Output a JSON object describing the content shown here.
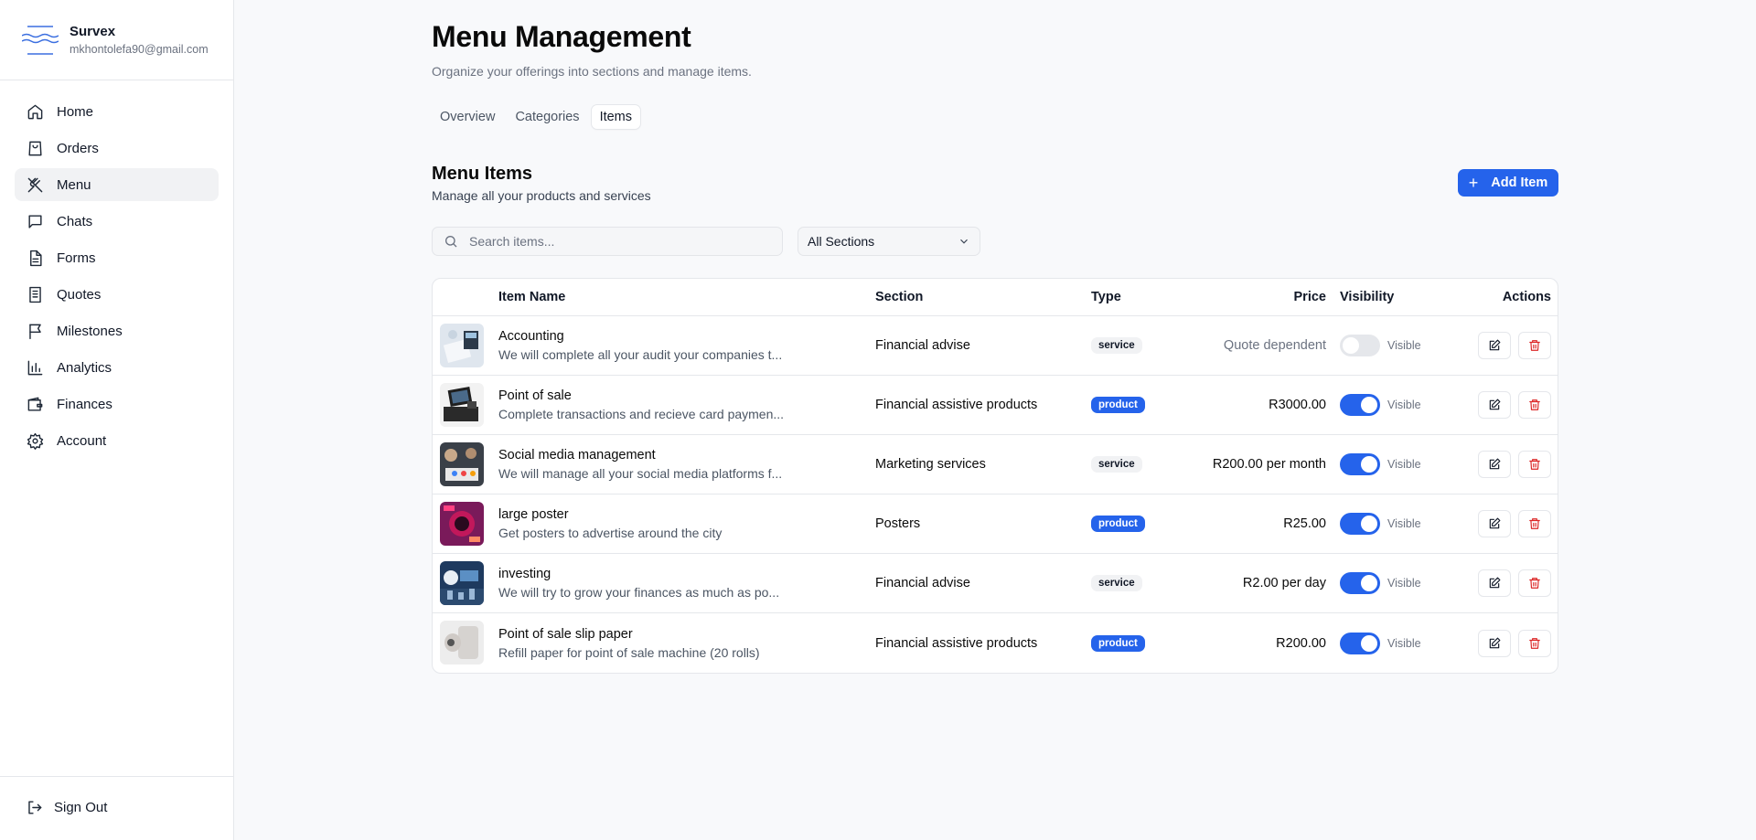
{
  "brand": {
    "name": "Survex",
    "email": "mkhontolefa90@gmail.com"
  },
  "sidebar": {
    "items": [
      {
        "label": "Home",
        "icon": "home-icon"
      },
      {
        "label": "Orders",
        "icon": "shopping-bag-icon"
      },
      {
        "label": "Menu",
        "icon": "utensils-icon",
        "active": true
      },
      {
        "label": "Chats",
        "icon": "message-square-icon"
      },
      {
        "label": "Forms",
        "icon": "file-text-icon"
      },
      {
        "label": "Quotes",
        "icon": "receipt-icon"
      },
      {
        "label": "Milestones",
        "icon": "flag-icon"
      },
      {
        "label": "Analytics",
        "icon": "bar-chart-icon"
      },
      {
        "label": "Finances",
        "icon": "wallet-icon"
      },
      {
        "label": "Account",
        "icon": "gear-icon"
      }
    ],
    "signout_label": "Sign Out"
  },
  "header": {
    "title": "Menu Management",
    "subtitle": "Organize your offerings into sections and manage items."
  },
  "tabs": [
    {
      "label": "Overview"
    },
    {
      "label": "Categories"
    },
    {
      "label": "Items",
      "active": true
    }
  ],
  "items_section": {
    "title": "Menu Items",
    "subtitle": "Manage all your products and services",
    "add_label": "Add Item",
    "search_placeholder": "Search items...",
    "section_filter": "All Sections"
  },
  "table": {
    "headers": {
      "name": "Item Name",
      "section": "Section",
      "type": "Type",
      "price": "Price",
      "visibility": "Visibility",
      "actions": "Actions"
    },
    "rows": [
      {
        "name": "Accounting",
        "desc": "We will complete all your audit your companies t...",
        "section": "Financial advise",
        "type": "service",
        "price": "Quote dependent",
        "visible": false,
        "vis_label": "Visible"
      },
      {
        "name": "Point of sale",
        "desc": "Complete transactions and recieve card paymen...",
        "section": "Financial assistive products",
        "type": "product",
        "price": "R3000.00",
        "visible": true,
        "vis_label": "Visible"
      },
      {
        "name": "Social media management",
        "desc": "We will manage all your social media platforms f...",
        "section": "Marketing services",
        "type": "service",
        "price": "R200.00 per month",
        "visible": true,
        "vis_label": "Visible"
      },
      {
        "name": "large poster",
        "desc": "Get posters to advertise around the city",
        "section": "Posters",
        "type": "product",
        "price": "R25.00",
        "visible": true,
        "vis_label": "Visible"
      },
      {
        "name": "investing",
        "desc": "We will try to grow your finances as much as po...",
        "section": "Financial advise",
        "type": "service",
        "price": "R2.00 per day",
        "visible": true,
        "vis_label": "Visible"
      },
      {
        "name": "Point of sale slip paper",
        "desc": "Refill paper for point of sale machine (20 rolls)",
        "section": "Financial assistive products",
        "type": "product",
        "price": "R200.00",
        "visible": true,
        "vis_label": "Visible"
      }
    ]
  },
  "colors": {
    "accent": "#2563eb",
    "danger": "#dc2626"
  }
}
